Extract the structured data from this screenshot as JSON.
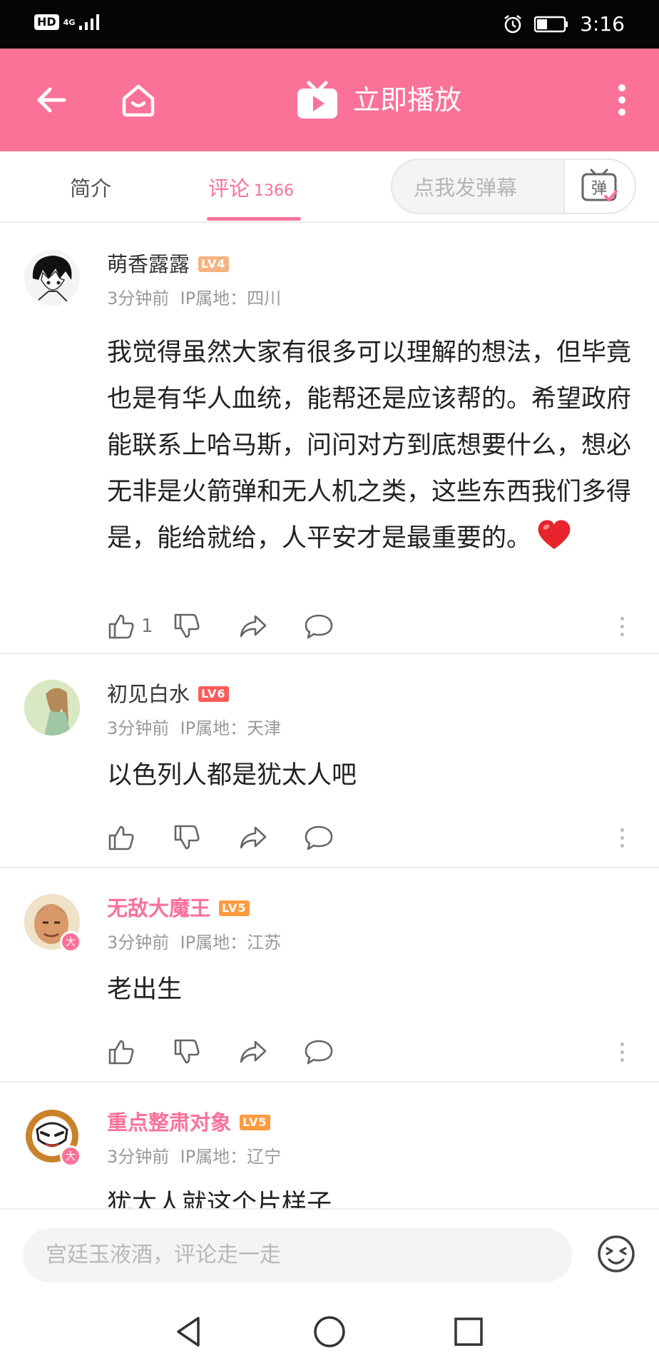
{
  "status_bar": {
    "network_hd": "HD",
    "network_type": "4G",
    "time": "3:16"
  },
  "header": {
    "play_label": "立即播放",
    "brand_color": "#fb7299"
  },
  "tabs": [
    {
      "label": "简介",
      "count": ""
    },
    {
      "label": "评论",
      "count": "1366"
    }
  ],
  "danmaku": {
    "placeholder": "点我发弹幕",
    "button_label": "弹"
  },
  "comments": [
    {
      "username": "萌香露露",
      "level": "LV4",
      "time": "3分钟前",
      "ip": "IP属地：四川",
      "text": "我觉得虽然大家有很多可以理解的想法，但毕竟也是有华人血统，能帮还是应该帮的。希望政府能联系上哈马斯，问问对方到底想要什么，想必无非是火箭弹和无人机之类，这些东西我们多得是，能给就给，人平安才是最重要的。",
      "emoji": "heart",
      "likes": "1"
    },
    {
      "username": "初见白水",
      "level": "LV6",
      "time": "3分钟前",
      "ip": "IP属地：天津",
      "text": "以色列人都是犹太人吧",
      "likes": ""
    },
    {
      "username": "无敌大魔王",
      "level": "LV5",
      "time": "3分钟前",
      "ip": "IP属地：江苏",
      "text": "老出生",
      "badge": "大",
      "likes": ""
    },
    {
      "username": "重点整肃对象",
      "level": "LV5",
      "time": "3分钟前",
      "ip": "IP属地：辽宁",
      "text": "犹太人就这个片样子",
      "badge": "大",
      "likes": ""
    }
  ],
  "comment_input": {
    "placeholder": "宫廷玉液酒，评论走一走"
  },
  "level_colors": {
    "LV4": "#f6b37f",
    "LV5": "#ff9b3f",
    "LV6": "#ff5c5c"
  }
}
